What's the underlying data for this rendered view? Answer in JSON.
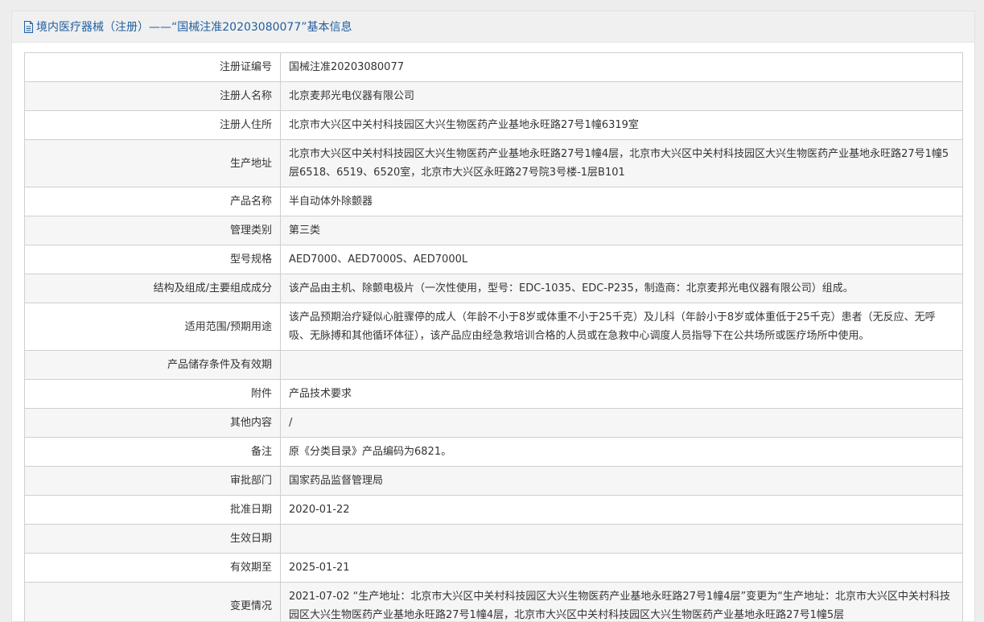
{
  "header": {
    "title": "境内医疗器械（注册）——“国械注准20203080077”基本信息"
  },
  "rows": [
    {
      "label": "注册证编号",
      "value": "国械注准20203080077"
    },
    {
      "label": "注册人名称",
      "value": "北京麦邦光电仪器有限公司"
    },
    {
      "label": "注册人住所",
      "value": "北京市大兴区中关村科技园区大兴生物医药产业基地永旺路27号1幢6319室"
    },
    {
      "label": "生产地址",
      "value": "北京市大兴区中关村科技园区大兴生物医药产业基地永旺路27号1幢4层，北京市大兴区中关村科技园区大兴生物医药产业基地永旺路27号1幢5层6518、6519、6520室，北京市大兴区永旺路27号院3号楼-1层B101"
    },
    {
      "label": "产品名称",
      "value": "半自动体外除颤器"
    },
    {
      "label": "管理类别",
      "value": "第三类"
    },
    {
      "label": "型号规格",
      "value": "AED7000、AED7000S、AED7000L"
    },
    {
      "label": "结构及组成/主要组成成分",
      "value": "该产品由主机、除颤电极片（一次性使用，型号：EDC-1035、EDC-P235，制造商：北京麦邦光电仪器有限公司）组成。"
    },
    {
      "label": "适用范围/预期用途",
      "value": "该产品预期治疗疑似心脏骤停的成人（年龄不小于8岁或体重不小于25千克）及儿科（年龄小于8岁或体重低于25千克）患者（无反应、无呼吸、无脉搏和其他循环体征），该产品应由经急救培训合格的人员或在急救中心调度人员指导下在公共场所或医疗场所中使用。"
    },
    {
      "label": "产品储存条件及有效期",
      "value": ""
    },
    {
      "label": "附件",
      "value": "产品技术要求"
    },
    {
      "label": "其他内容",
      "value": "/"
    },
    {
      "label": "备注",
      "value": "原《分类目录》产品编码为6821。"
    },
    {
      "label": "审批部门",
      "value": "国家药品监督管理局"
    },
    {
      "label": "批准日期",
      "value": "2020-01-22"
    },
    {
      "label": "生效日期",
      "value": ""
    },
    {
      "label": "有效期至",
      "value": "2025-01-21"
    },
    {
      "label": "变更情况",
      "value": "2021-07-02 “生产地址：北京市大兴区中关村科技园区大兴生物医药产业基地永旺路27号1幢4层”变更为“生产地址：北京市大兴区中关村科技园区大兴生物医药产业基地永旺路27号1幢4层，北京市大兴区中关村科技园区大兴生物医药产业基地永旺路27号1幢5层"
    }
  ]
}
